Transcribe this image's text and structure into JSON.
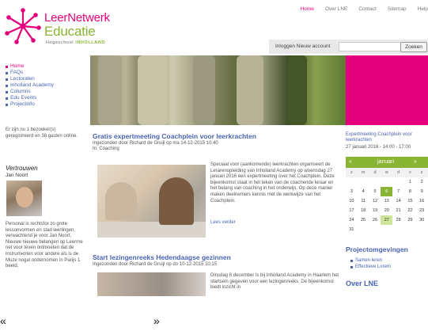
{
  "header": {
    "logo": {
      "line1": "LeerNetwerk",
      "line2": "Educatie",
      "tagline_a": "Hogeschool",
      "tagline_b": "INHOLLAND"
    },
    "topnav": [
      "Home",
      "Over LNE",
      "Contact",
      "Sitemap",
      "Help"
    ],
    "login_label": "Inloggen  Nieuw account",
    "search_placeholder": "",
    "search_button": "Zoeken"
  },
  "sidebar": {
    "items": [
      {
        "label": "Home",
        "active": true
      },
      {
        "label": "FAQs",
        "active": false
      },
      {
        "label": "Lectoraten",
        "active": false
      },
      {
        "label": "Inholland Academy",
        "active": false
      },
      {
        "label": "Columns",
        "active": false
      },
      {
        "label": "Edu Events",
        "active": false
      },
      {
        "label": "Projectinfo",
        "active": false
      }
    ],
    "note": "Er zijn nu 1 bezoeker(s) geregistreerd en 38 gasten online.",
    "vh_title": "Vertrouwen",
    "vh_name": "Jan Noort",
    "vh_text": "Personal is rechtsfor zo grote lessonvormen en stad leerlingen, verwachtend je voor Jan Noort, Nieuwe nieuwe belangen op Leerrne net voor teven ontmoeten dat de instrumenten voor andere als is de Muze nogal ondernomen in Parijs 1 beeld."
  },
  "article1": {
    "title": "Gratis expertmeeting Coachplein voor leerkrachten",
    "meta": "Ingezonden door Richard de Gruijl op ma 14-12-2015 10:40",
    "category": "In: Coaching",
    "body": "Speciaal voor (aankomende) leerkrachten organiseert de Lerarenopleiding van Inholland Academy op woensdag 27 januari 2016 een expertmeeting over het Coachplein. Deze bijeenkomst staat in het teken van de coachende leraar en het belang van coaching in het onderwijs. Op deze manier maken deelnemers kennis met de werkwijze van het Coachplein.",
    "read_more": "Lees verder"
  },
  "article2": {
    "title": "Start lezingenreeks Hedendaagse gezinnen",
    "meta": "Ingezonden door Richard de Gruijl op do 10-12-2015 10:15",
    "body": "Dinsdag 8 december is bij Inholland Academy in Haarlem het startsein gegeven voor een lezingenreeks. De bijeenkomst biedt inzicht in"
  },
  "events": {
    "title": "Expertmeeting Coachplein voor leerkrachten",
    "date": "27 januari 2016 - 14:00 - 17:00"
  },
  "calendar": {
    "prev": "«",
    "month": "januari",
    "next": "»",
    "dow": [
      "z",
      "m",
      "d",
      "w",
      "d",
      "v",
      "z"
    ],
    "rows": [
      [
        "",
        "",
        "",
        "",
        "",
        "1",
        "2"
      ],
      [
        "3",
        "4",
        "5",
        "6",
        "7",
        "8",
        "9"
      ],
      [
        "10",
        "11",
        "12",
        "13",
        "14",
        "15",
        "16"
      ],
      [
        "17",
        "18",
        "19",
        "20",
        "21",
        "22",
        "23"
      ],
      [
        "24",
        "25",
        "26",
        "27",
        "28",
        "29",
        "30"
      ],
      [
        "31",
        "",
        "",
        "",
        "",
        "",
        ""
      ]
    ]
  },
  "projects": {
    "title": "Projectomgevingen",
    "items": [
      "Samen leren",
      "Effectieve Lorem"
    ]
  },
  "over": "Over LNE",
  "pager": {
    "prev": "«",
    "next": "»"
  },
  "colors": {
    "magenta": "#e4007c",
    "green": "#8ab534",
    "link": "#4a63b2"
  }
}
